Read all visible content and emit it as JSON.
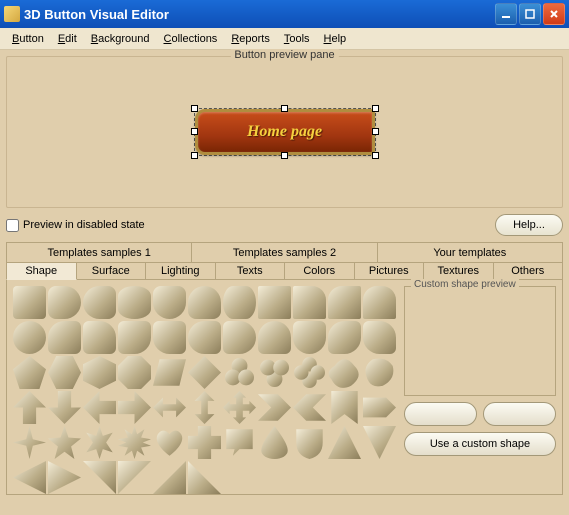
{
  "window": {
    "title": "3D Button Visual Editor"
  },
  "menu": [
    "Button",
    "Edit",
    "Background",
    "Collections",
    "Reports",
    "Tools",
    "Help"
  ],
  "preview": {
    "legend": "Button preview pane",
    "button_text": "Home page"
  },
  "checkbox": {
    "label": "Preview in disabled state",
    "checked": false
  },
  "help_label": "Help...",
  "top_tabs": [
    "Templates samples 1",
    "Templates samples 2",
    "Your templates"
  ],
  "sub_tabs": [
    "Shape",
    "Surface",
    "Lighting",
    "Texts",
    "Colors",
    "Pictures",
    "Textures",
    "Others"
  ],
  "active_sub_tab": 0,
  "custom_legend": "Custom shape preview",
  "use_custom": "Use a custom shape"
}
